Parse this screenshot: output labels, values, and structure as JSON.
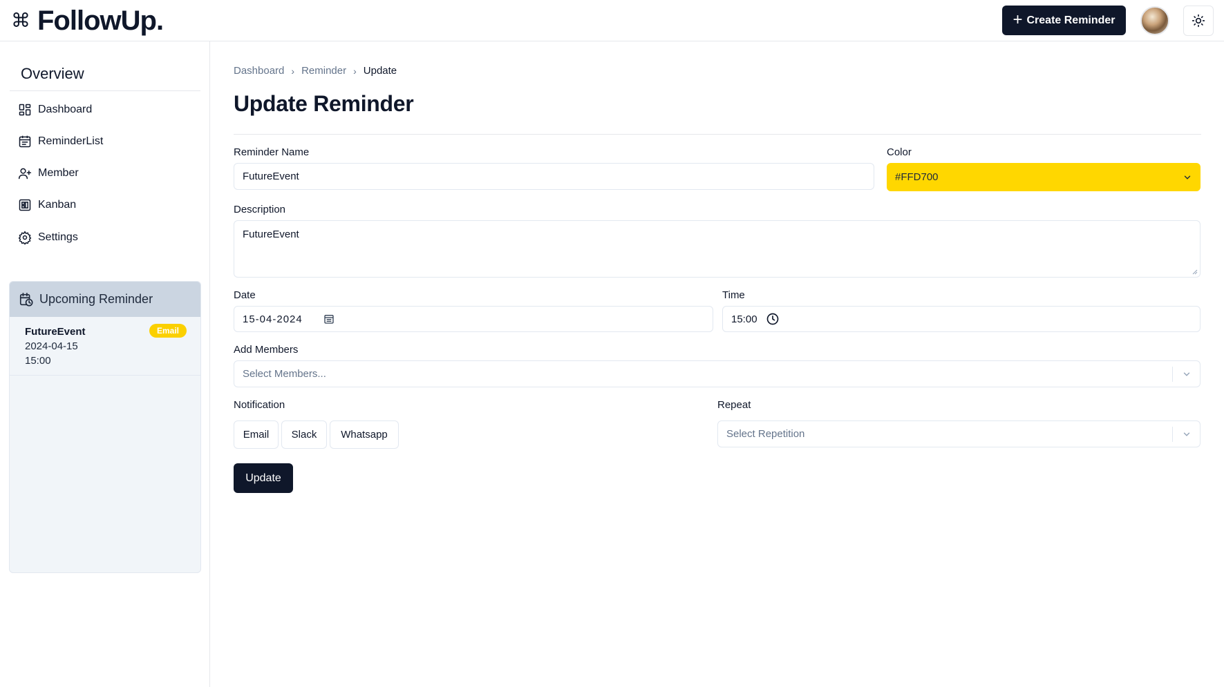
{
  "header": {
    "logo_icon": "⌘",
    "logo_text": "FollowUp.",
    "create_button": "Create Reminder",
    "avatar_icon": "avatar",
    "theme_icon": "sun-icon"
  },
  "sidebar": {
    "heading": "Overview",
    "items": [
      {
        "label": "Dashboard",
        "icon": "dashboard-icon"
      },
      {
        "label": "ReminderList",
        "icon": "calendar-list-icon"
      },
      {
        "label": "Member",
        "icon": "user-plus-icon"
      },
      {
        "label": "Kanban",
        "icon": "kanban-icon"
      },
      {
        "label": "Settings",
        "icon": "gear-icon"
      }
    ],
    "upcoming": {
      "title": "Upcoming Reminder",
      "icon": "calendar-clock-icon",
      "items": [
        {
          "name": "FutureEvent",
          "date": "2024-04-15",
          "time": "15:00",
          "badge": "Email"
        }
      ]
    }
  },
  "breadcrumb": [
    "Dashboard",
    "Reminder",
    "Update"
  ],
  "page_title": "Update Reminder",
  "form": {
    "reminder_name": {
      "label": "Reminder Name",
      "value": "FutureEvent"
    },
    "color": {
      "label": "Color",
      "value": "#FFD700"
    },
    "description": {
      "label": "Description",
      "value": "FutureEvent"
    },
    "date": {
      "label": "Date",
      "value": "15-04-2024"
    },
    "time": {
      "label": "Time",
      "value": "15:00"
    },
    "members": {
      "label": "Add Members",
      "placeholder": "Select Members..."
    },
    "notification": {
      "label": "Notification",
      "options": [
        "Email",
        "Slack",
        "Whatsapp"
      ]
    },
    "repeat": {
      "label": "Repeat",
      "placeholder": "Select Repetition"
    },
    "submit": "Update"
  },
  "colors": {
    "primary": "#0f172a",
    "accent_yellow": "#FFD700",
    "sidebar_card": "#f1f5f9",
    "sidebar_card_header": "#cbd5e1"
  }
}
